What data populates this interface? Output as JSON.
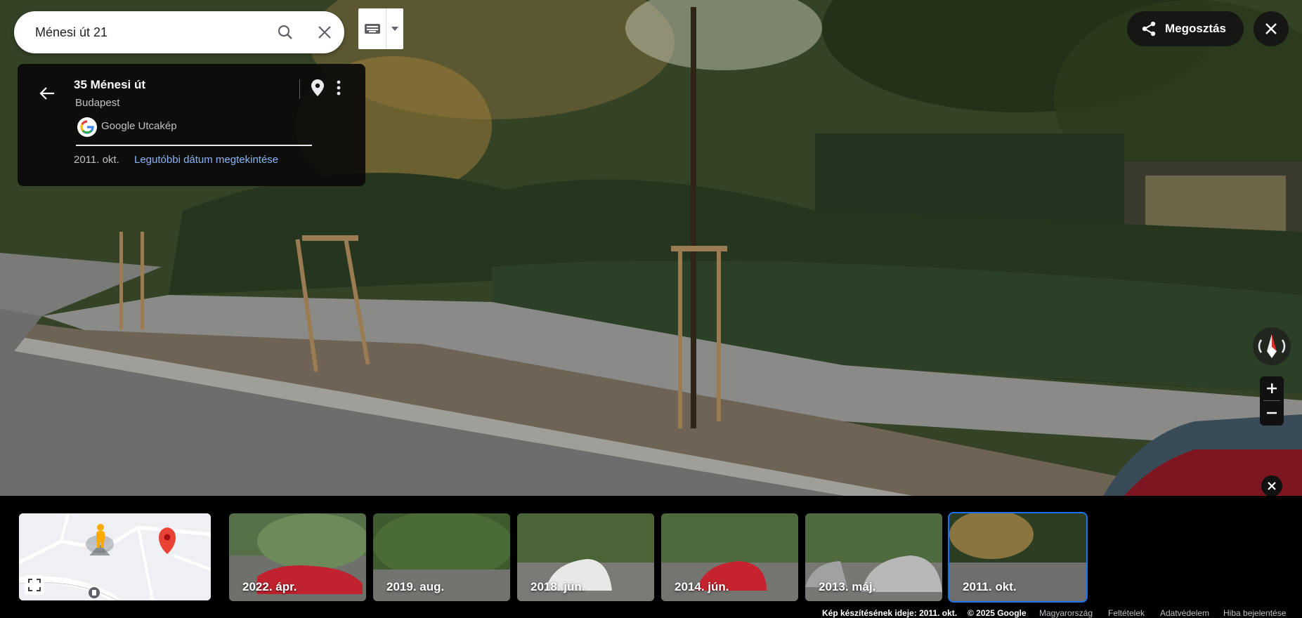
{
  "search": {
    "value": "Ménesi út 21"
  },
  "card": {
    "title": "35 Ménesi út",
    "city": "Budapest",
    "source": "Google Utcakép",
    "date": "2011. okt.",
    "latest_link": "Legutóbbi dátum megtekintése"
  },
  "share": {
    "label": "Megosztás"
  },
  "timeline": [
    {
      "label": "2022. ápr."
    },
    {
      "label": "2019. aug."
    },
    {
      "label": "2018. jún."
    },
    {
      "label": "2014. jún."
    },
    {
      "label": "2013. máj."
    },
    {
      "label": "2011. okt."
    }
  ],
  "footer": {
    "capture": "Kép készítésének ideje: 2011. okt.",
    "copyright": "© 2025 Google",
    "country": "Magyarország",
    "terms": "Feltételek",
    "privacy": "Adatvédelem",
    "report": "Hiba bejelentése"
  },
  "colors": {
    "accent": "#1a73e8",
    "link": "#8ab4f8",
    "pin": "#ea4335"
  }
}
